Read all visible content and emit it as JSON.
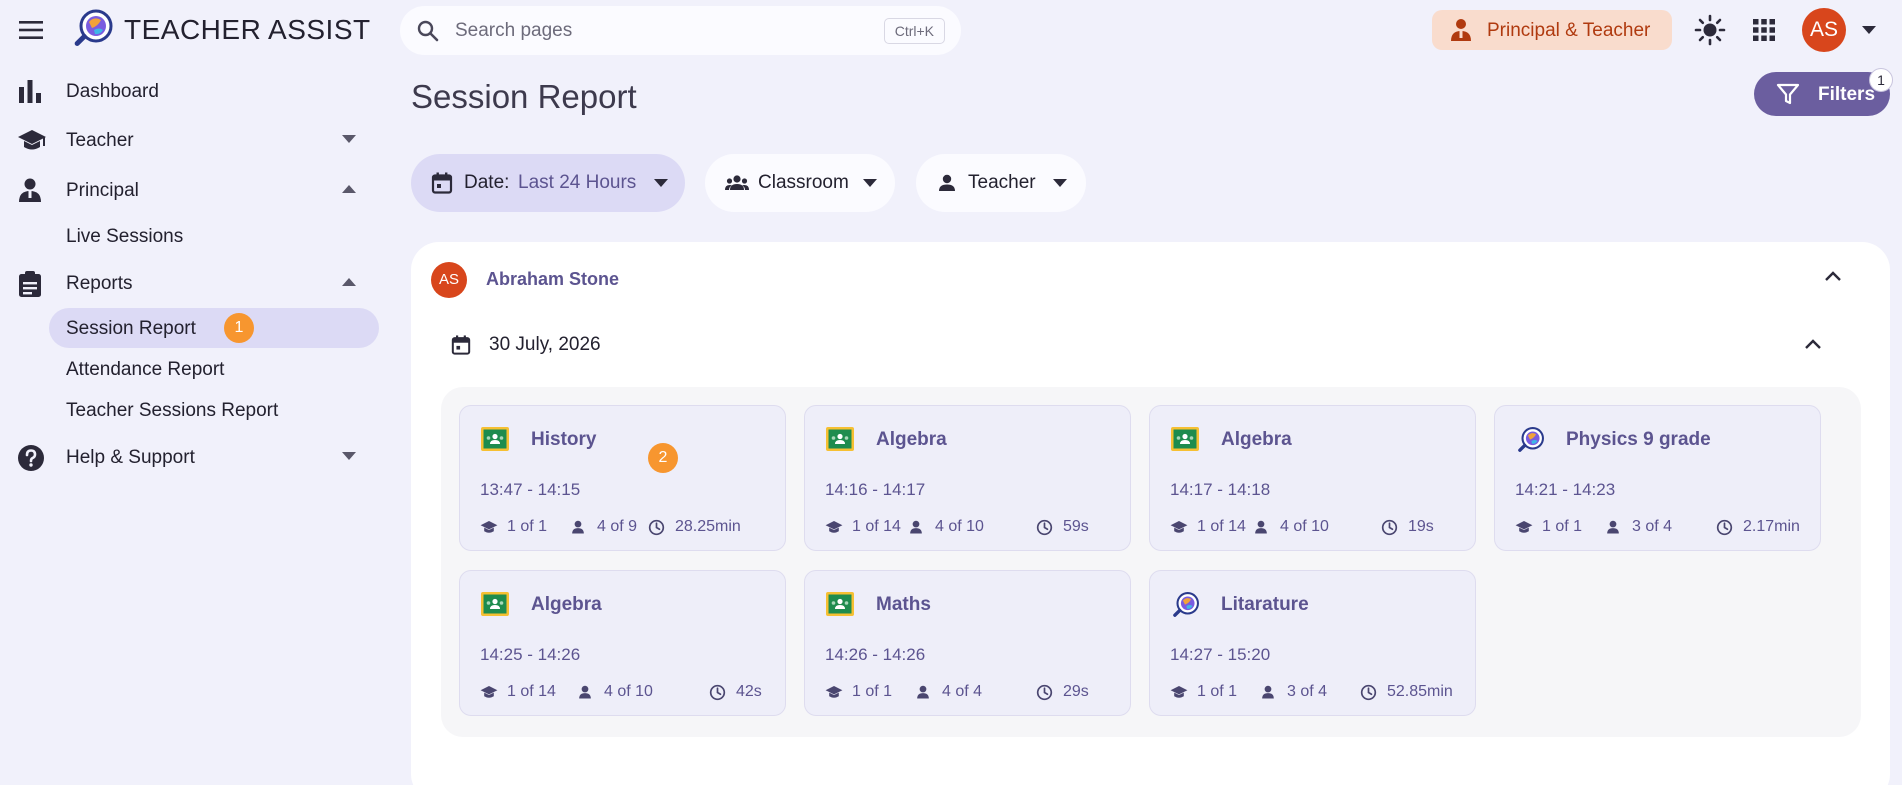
{
  "app": {
    "title": "TEACHER ASSIST",
    "search_placeholder": "Search pages",
    "search_shortcut": "Ctrl+K",
    "role": "Principal & Teacher",
    "user_initials": "AS"
  },
  "sidebar": {
    "dashboard": "Dashboard",
    "teacher": "Teacher",
    "principal": "Principal",
    "live_sessions": "Live Sessions",
    "reports": "Reports",
    "session_report": "Session Report",
    "session_report_badge": "1",
    "attendance_report": "Attendance Report",
    "teacher_sessions_report": "Teacher Sessions Report",
    "help": "Help & Support"
  },
  "main": {
    "page_title": "Session Report",
    "filters_label": "Filters",
    "filters_count": "1",
    "date_label": "Date:",
    "date_value": "Last 24 Hours",
    "classroom_label": "Classroom",
    "teacher_label": "Teacher"
  },
  "report": {
    "teacher_initials": "AS",
    "teacher_name": "Abraham Stone",
    "date": "30 July, 2026",
    "card_badge": "2",
    "sessions": [
      {
        "title": "History",
        "time": "13:47 - 14:15",
        "classes": "1 of 1",
        "students": "4 of 9",
        "duration": "28.25min",
        "icon": "google-classroom-icon"
      },
      {
        "title": "Algebra",
        "time": "14:16 - 14:17",
        "classes": "1 of 14",
        "students": "4 of 10",
        "duration": "59s",
        "icon": "google-classroom-icon"
      },
      {
        "title": "Algebra",
        "time": "14:17 - 14:18",
        "classes": "1 of 14",
        "students": "4 of 10",
        "duration": "19s",
        "icon": "google-classroom-icon"
      },
      {
        "title": "Physics 9 grade",
        "time": "14:21 - 14:23",
        "classes": "1 of 1",
        "students": "3 of 4",
        "duration": "2.17min",
        "icon": "teacher-assist-icon"
      },
      {
        "title": "Algebra",
        "time": "14:25 - 14:26",
        "classes": "1 of 14",
        "students": "4 of 10",
        "duration": "42s",
        "icon": "google-classroom-icon"
      },
      {
        "title": "Maths",
        "time": "14:26 - 14:26",
        "classes": "1 of 1",
        "students": "4 of 4",
        "duration": "29s",
        "icon": "google-classroom-icon"
      },
      {
        "title": "Litarature",
        "time": "14:27 - 15:20",
        "classes": "1 of 1",
        "students": "3 of 4",
        "duration": "52.85min",
        "icon": "teacher-assist-icon"
      }
    ]
  },
  "colors": {
    "background": "#f1f1fb",
    "accent": "#6b5e9f",
    "avatar": "#d8461c",
    "badge": "#f7962f",
    "role_chip": "#f9dccd"
  }
}
